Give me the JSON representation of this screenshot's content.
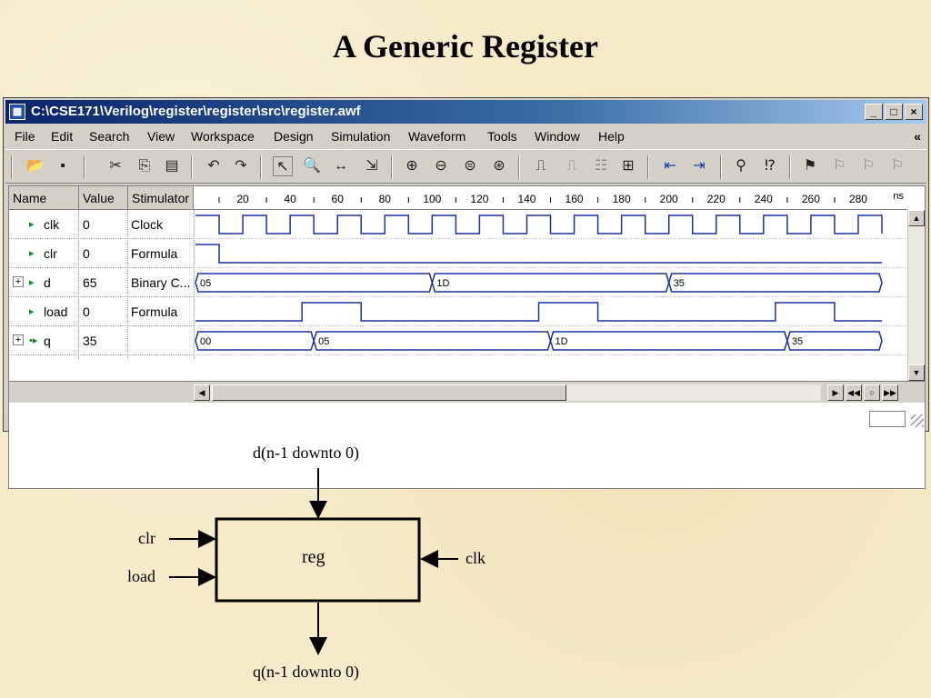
{
  "slide": {
    "title": "A Generic Register"
  },
  "window": {
    "title": "C:\\CSE171\\Verilog\\register\\register\\src\\register.awf",
    "controls": {
      "minimize": "_",
      "maximize": "□",
      "close": "×"
    }
  },
  "menu": [
    "File",
    "Edit",
    "Search",
    "View",
    "Workspace",
    "Design",
    "Simulation",
    "Waveform",
    "Tools",
    "Window",
    "Help"
  ],
  "menu_overflow": "«",
  "toolbar_icons": [
    "open-folder-icon",
    "save-icon",
    "cut-icon",
    "copy-icon",
    "paste-icon",
    "undo-icon",
    "redo-icon",
    "select-pointer-icon",
    "zoom-icon",
    "measure-icon",
    "select-region-icon",
    "zoom-in-icon",
    "zoom-out-icon",
    "zoom-fit-icon",
    "zoom-range-icon",
    "add-signal-icon",
    "clock-icon",
    "bus-icon",
    "stimulator-icon",
    "run-icon",
    "step-icon",
    "find-icon",
    "find-next-icon",
    "marker-icon",
    "marker-add-icon",
    "marker-remove-icon",
    "marker-clear-icon"
  ],
  "grid": {
    "headers": {
      "name": "Name",
      "value": "Value",
      "stimulator": "Stimulator"
    },
    "unit": "ns",
    "ticks": [
      "20",
      "40",
      "60",
      "80",
      "100",
      "120",
      "140",
      "160",
      "180",
      "200",
      "220",
      "240",
      "260",
      "280"
    ],
    "signals": [
      {
        "name": "clk",
        "value": "0",
        "stimulator": "Clock",
        "expandable": false
      },
      {
        "name": "clr",
        "value": "0",
        "stimulator": "Formula",
        "expandable": false
      },
      {
        "name": "d",
        "value": "65",
        "stimulator": "Binary C...",
        "expandable": true
      },
      {
        "name": "load",
        "value": "0",
        "stimulator": "Formula",
        "expandable": false
      },
      {
        "name": "q",
        "value": "35",
        "stimulator": "",
        "expandable": true
      }
    ],
    "expand_glyph": "+",
    "bus_values": {
      "d": [
        {
          "t": 0,
          "label": "05"
        },
        {
          "t": 100,
          "label": "1D"
        },
        {
          "t": 200,
          "label": "35"
        }
      ],
      "q": [
        {
          "t": 0,
          "label": "00"
        },
        {
          "t": 50,
          "label": "05"
        },
        {
          "t": 150,
          "label": "1D"
        },
        {
          "t": 250,
          "label": "35"
        }
      ]
    },
    "clk_period_ns": 20,
    "clr_high_until_ns": 10,
    "load_high": [
      [
        45,
        70
      ],
      [
        145,
        170
      ],
      [
        245,
        270
      ]
    ],
    "time_range_ns": [
      0,
      290
    ]
  },
  "diagram": {
    "input_top": "d(n-1 downto 0)",
    "block": "reg",
    "left_inputs": [
      "clr",
      "load"
    ],
    "right_input": "clk",
    "output_bottom": "q(n-1 downto 0)"
  }
}
